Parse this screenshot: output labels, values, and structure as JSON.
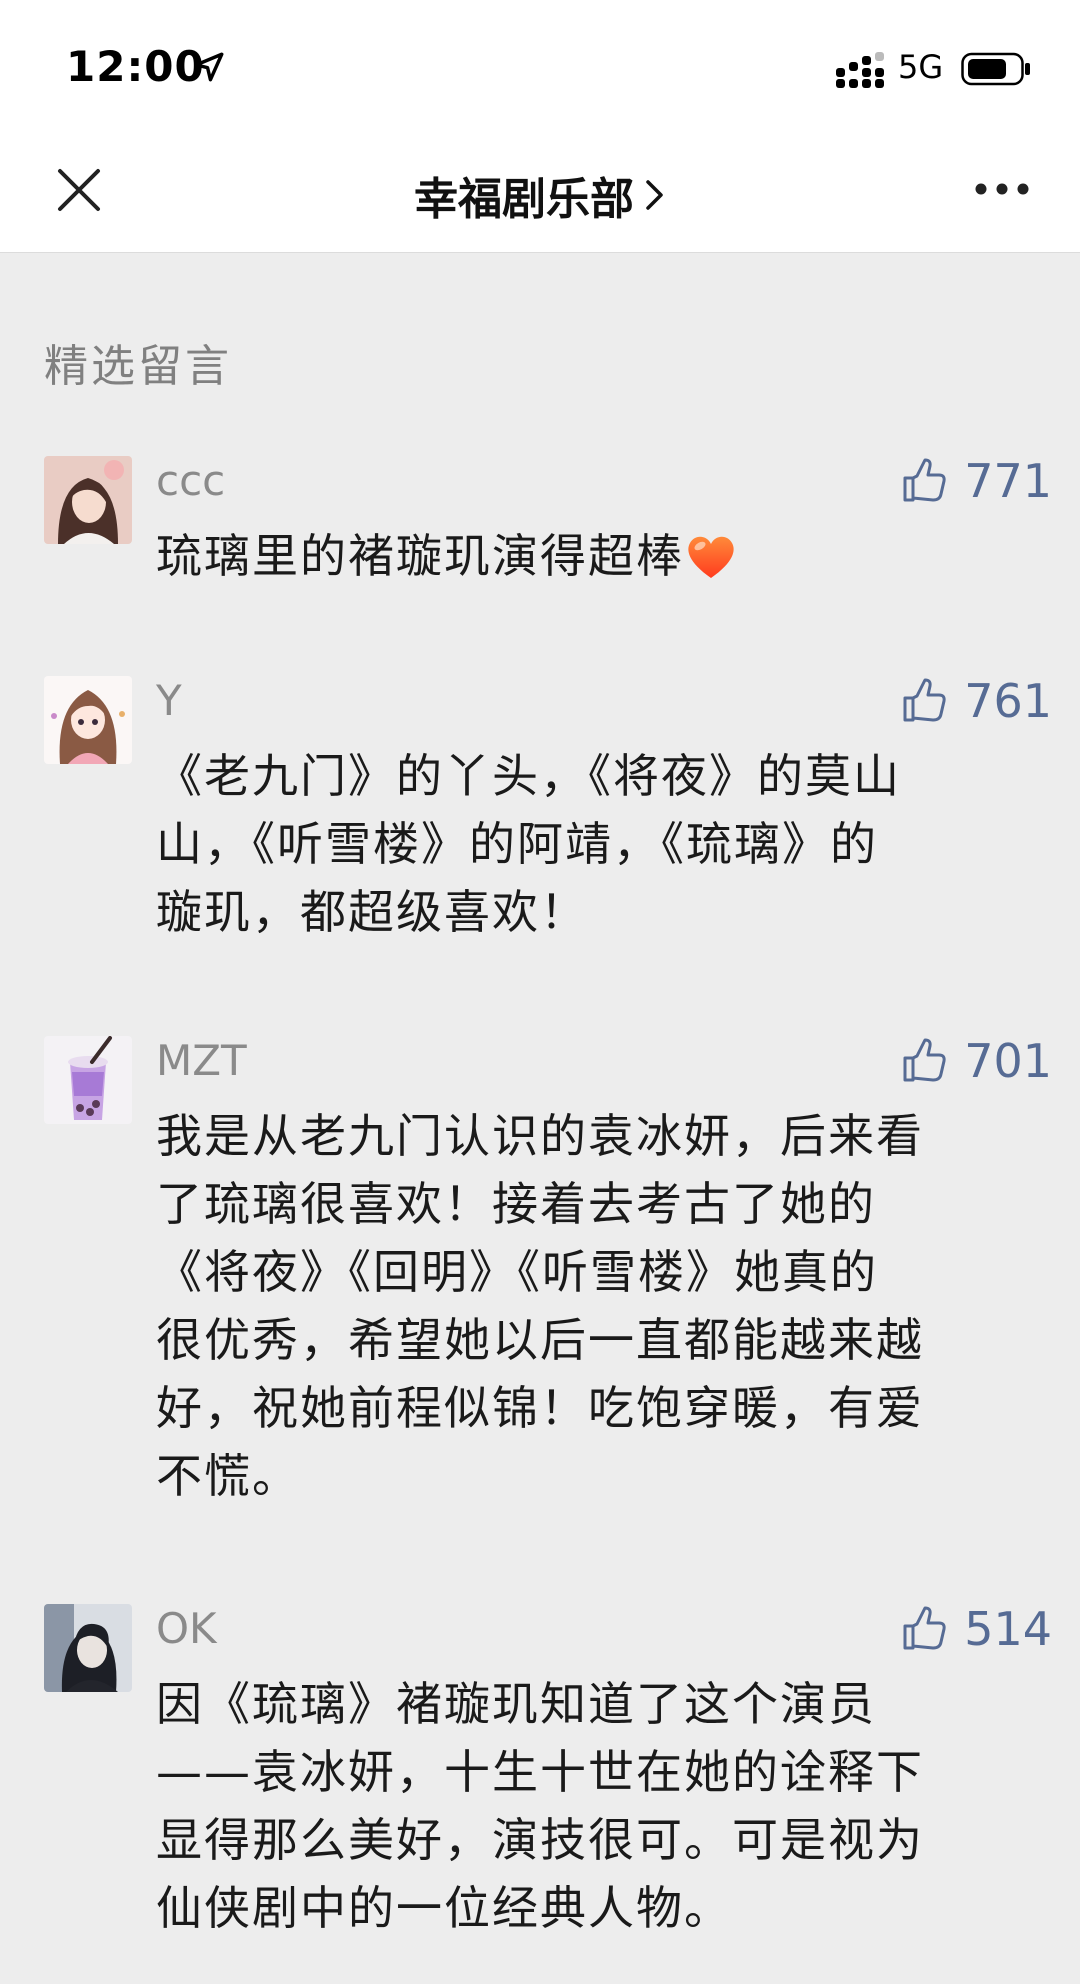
{
  "status_bar": {
    "time": "12:00",
    "network": "5G"
  },
  "nav": {
    "title": "幸福剧乐部"
  },
  "section": {
    "label": "精选留言"
  },
  "comments": [
    {
      "name": "ccc",
      "likes": "771",
      "text": "琉璃里的褚璇玑演得超棒"
    },
    {
      "name": "Y",
      "likes": "761",
      "lines": [
        "《老九门》的丫头，《将夜》的莫山",
        "山，《听雪楼》的阿靖，《琉璃》的",
        "璇玑，都超级喜欢！"
      ]
    },
    {
      "name": "MZT",
      "likes": "701",
      "lines": [
        "我是从老九门认识的袁冰妍，后来看",
        "了琉璃很喜欢！接着去考古了她的",
        "《将夜》《回明》《听雪楼》她真的",
        "很优秀，希望她以后一直都能越来越",
        "好，祝她前程似锦！吃饱穿暖，有爱",
        "不慌。"
      ]
    },
    {
      "name": "OK",
      "likes": "514",
      "lines": [
        "因《琉璃》褚璇玑知道了这个演员",
        "——袁冰妍，十生十世在她的诠释下",
        "显得那么美好，演技很可。可是视为",
        "仙侠剧中的一位经典人物。"
      ]
    }
  ],
  "icons": {
    "like": "thumbs-up-icon",
    "close": "close-icon",
    "more": "more-dots-icon",
    "heart": "heart-icon"
  },
  "colors": {
    "like_blue": "#566b94",
    "name_gray": "#8a8a8a",
    "background": "#ededed"
  }
}
